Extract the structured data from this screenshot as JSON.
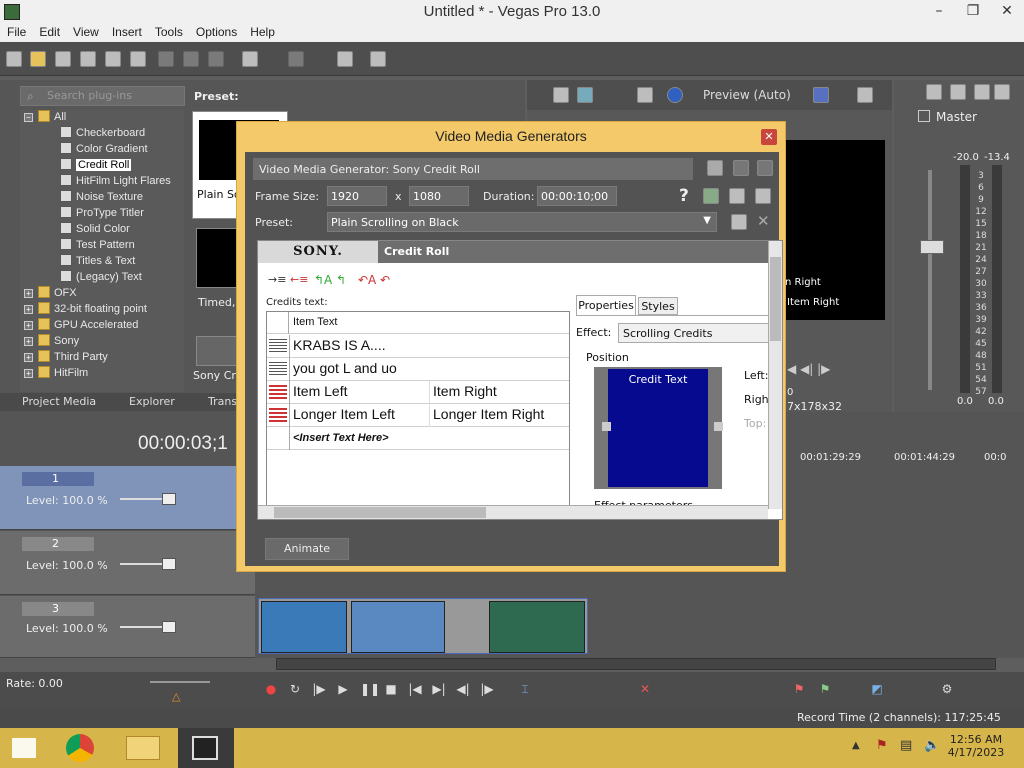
{
  "window": {
    "title": "Untitled * - Vegas Pro 13.0",
    "minimize": "–",
    "maximize": "❐",
    "close": "✕"
  },
  "menu": [
    "File",
    "Edit",
    "View",
    "Insert",
    "Tools",
    "Options",
    "Help"
  ],
  "plugins": {
    "search_placeholder": "Search plug-ins",
    "tree": [
      {
        "label": "All",
        "type": "folder",
        "expanded": true
      },
      {
        "label": "Checkerboard",
        "type": "gen"
      },
      {
        "label": "Color Gradient",
        "type": "gen"
      },
      {
        "label": "Credit Roll",
        "type": "gen",
        "selected": true
      },
      {
        "label": "HitFilm Light Flares",
        "type": "gen"
      },
      {
        "label": "Noise Texture",
        "type": "gen"
      },
      {
        "label": "ProType Titler",
        "type": "gen"
      },
      {
        "label": "Solid Color",
        "type": "gen"
      },
      {
        "label": "Test Pattern",
        "type": "gen"
      },
      {
        "label": "Titles & Text",
        "type": "gen"
      },
      {
        "label": "(Legacy) Text",
        "type": "gen"
      },
      {
        "label": "OFX",
        "type": "folder"
      },
      {
        "label": "32-bit floating point",
        "type": "folder"
      },
      {
        "label": "GPU Accelerated",
        "type": "folder"
      },
      {
        "label": "Sony",
        "type": "folder"
      },
      {
        "label": "Third Party",
        "type": "folder"
      },
      {
        "label": "HitFilm",
        "type": "folder"
      }
    ],
    "preset_label": "Preset:",
    "thumbs": [
      "Plain Scr",
      "Timed, F",
      "Sony Cre"
    ]
  },
  "panel_tabs": [
    "Project Media",
    "Explorer",
    "Transi"
  ],
  "preview": {
    "mode": "Preview (Auto)",
    "right_text": [
      "n Right",
      "Item Right"
    ],
    "size": "7x178x32",
    "zero": "0"
  },
  "master": {
    "title": "Master",
    "left_db": "-20.0",
    "right_db": "-13.4",
    "scale": [
      "3",
      "6",
      "9",
      "12",
      "15",
      "18",
      "21",
      "24",
      "27",
      "30",
      "33",
      "36",
      "39",
      "42",
      "45",
      "48",
      "51",
      "54",
      "57"
    ],
    "bottom_left": "0.0",
    "bottom_right": "0.0"
  },
  "timeline": {
    "timecode": "00:00:03;1",
    "ruler": [
      "00:01:29:29",
      "00:01:44:29",
      "00:0"
    ],
    "tracks": [
      {
        "num": "1",
        "level": "Level: 100.0 %"
      },
      {
        "num": "2",
        "level": "Level: 100.0 %"
      },
      {
        "num": "3",
        "level": "Level: 100.0 %"
      }
    ],
    "rate": "Rate: 0.00",
    "record_time": "Record Time (2 channels): 117:25:45"
  },
  "dialog": {
    "title": "Video Media Generators",
    "close": "✕",
    "generator_label": "Video Media Generator:  Sony Credit Roll",
    "frame_size_label": "Frame Size:",
    "frame_w": "1920",
    "x": "x",
    "frame_h": "1080",
    "duration_label": "Duration:",
    "duration": "00:00:10;00",
    "preset_label": "Preset:",
    "preset": "Plain Scrolling on Black",
    "sony": "SONY.",
    "credit_roll": "Credit Roll",
    "credits_text_label": "Credits text:",
    "table_header": "Item Text",
    "rows": [
      {
        "kind": "hdr",
        "left": "KRABS IS A....",
        "right": ""
      },
      {
        "kind": "text",
        "left": "you got L and uo",
        "right": ""
      },
      {
        "kind": "dual",
        "left": "Item Left",
        "right": "Item Right"
      },
      {
        "kind": "dual",
        "left": "Longer Item Left",
        "right": "Longer Item Right"
      },
      {
        "kind": "insert",
        "left": "<Insert Text Here>",
        "right": ""
      }
    ],
    "tab_properties": "Properties",
    "tab_styles": "Styles",
    "effect_label": "Effect:",
    "effect": "Scrolling Credits",
    "position_label": "Position",
    "position_box": "Credit Text",
    "left_label": "Left:",
    "right_label": "Righ",
    "top_label": "Top:",
    "effect_params": "Effect parameters",
    "animate": "Animate",
    "help": "?"
  },
  "taskbar": {
    "time": "12:56 AM",
    "date": "4/17/2023"
  }
}
